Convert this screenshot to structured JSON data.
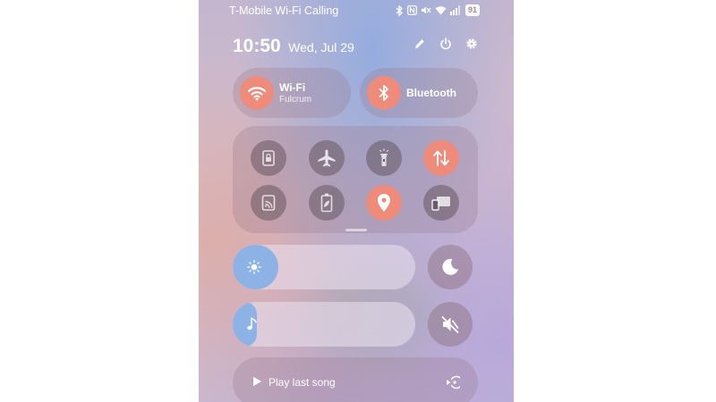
{
  "status_bar": {
    "carrier": "T-Mobile Wi-Fi Calling",
    "icons": [
      "bluetooth-icon",
      "nfc-icon",
      "mute-icon",
      "wifi-icon",
      "signal-icon"
    ],
    "battery": "91"
  },
  "header": {
    "time": "10:50",
    "date": "Wed, Jul 29",
    "actions": [
      "edit-icon",
      "power-icon",
      "settings-icon"
    ]
  },
  "wifi": {
    "title": "Wi-Fi",
    "subtitle": "Fulcrum",
    "on": true
  },
  "bluetooth": {
    "title": "Bluetooth",
    "on": true
  },
  "quick_tiles": [
    {
      "icon": "lock-screen-icon",
      "on": false
    },
    {
      "icon": "airplane-icon",
      "on": false
    },
    {
      "icon": "flashlight-icon",
      "on": false
    },
    {
      "icon": "mobile-data-icon",
      "on": true
    },
    {
      "icon": "cast-icon",
      "on": false
    },
    {
      "icon": "battery-saver-icon",
      "on": false
    },
    {
      "icon": "location-icon",
      "on": true
    },
    {
      "icon": "screen-mirror-icon",
      "on": false
    }
  ],
  "brightness": {
    "icon": "sun-icon",
    "level_fraction": 0.25
  },
  "volume": {
    "icon": "music-note-icon",
    "level_fraction": 0.13
  },
  "dark_mode": {
    "icon": "moon-icon"
  },
  "mute": {
    "icon": "mute-icon"
  },
  "media": {
    "label": "Play last song",
    "icon": "play-icon",
    "output_icon": "audio-output-icon"
  },
  "colors": {
    "accent_on": "#ee8b7a",
    "slider_fill": "#8db3e6",
    "text": "#ffffff"
  }
}
